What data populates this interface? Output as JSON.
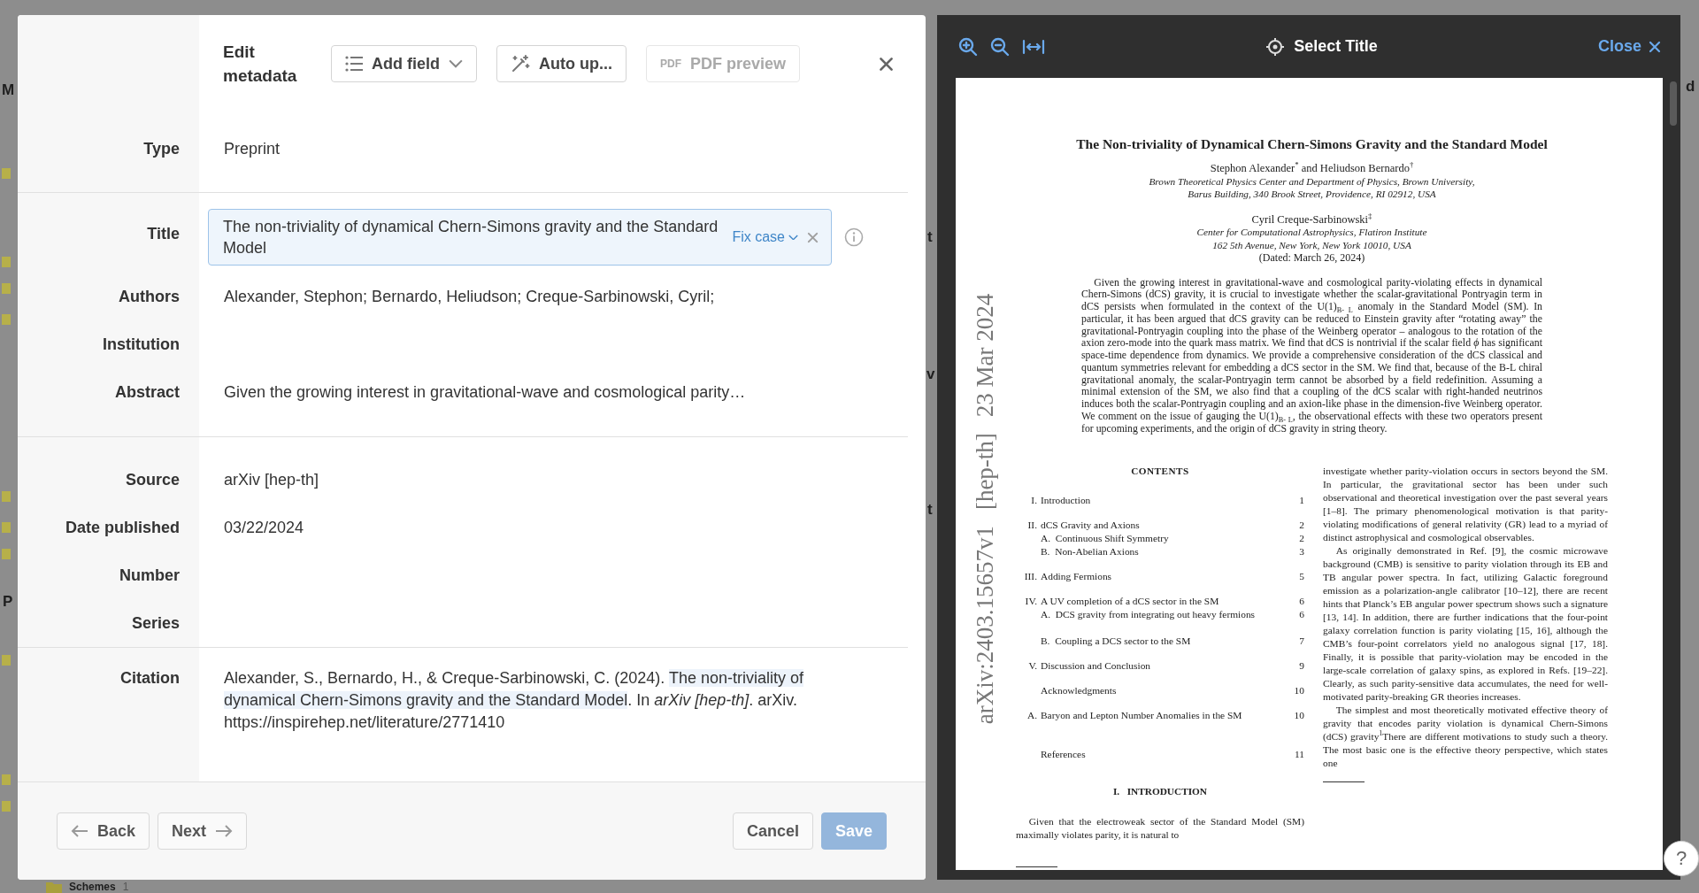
{
  "background": {
    "fragments": [
      {
        "text": "M"
      },
      {
        "text": "P"
      },
      {
        "text": "t"
      },
      {
        "text": "v"
      },
      {
        "text": "t"
      },
      {
        "text": "d"
      }
    ],
    "folder": {
      "name": "Schemes",
      "count": "1"
    }
  },
  "dialog": {
    "title": "Edit metadata",
    "toolbar": [
      {
        "kind": "list",
        "label": "Add field",
        "dropdown": true,
        "disabled": false
      },
      {
        "kind": "wand",
        "label": "Auto up...",
        "dropdown": false,
        "disabled": false
      },
      {
        "kind": "pdf",
        "badge": "PDF",
        "label": "PDF preview",
        "dropdown": false,
        "disabled": true
      }
    ],
    "groups": [
      [
        {
          "label": "Type",
          "value": "Preprint",
          "kind": "text"
        }
      ],
      [
        {
          "label": "Title",
          "value": "The non-triviality of dynamical Chern-Simons gravity and the Standard Model",
          "kind": "input",
          "action": "Fix case"
        },
        {
          "label": "Authors",
          "value": "Alexander, Stephon; Bernardo, Heliudson; Creque-Sarbinowski, Cyril;",
          "kind": "text"
        },
        {
          "label": "Institution",
          "kind": "text"
        },
        {
          "label": "Abstract",
          "value": "Given the growing interest in gravitational-wave and cosmological parity…",
          "kind": "text"
        }
      ],
      [
        {
          "label": "Source",
          "value": "arXiv [hep-th]",
          "kind": "text"
        },
        {
          "label": "Date published",
          "value": "03/22/2024",
          "kind": "text"
        },
        {
          "label": "Number",
          "kind": "text"
        },
        {
          "label": "Series",
          "kind": "text"
        }
      ]
    ],
    "citation": {
      "label": "Citation",
      "before": "Alexander, S., Bernardo, H., & Creque-Sarbinowski, C. (2024). ",
      "highlight": "The non-triviality of dynamical Chern-Simons gravity and the Standard Model",
      "after": ". In *arXiv [hep-th]*. arXiv. https://inspirehep.net/literature/2771410"
    },
    "footer": {
      "back": "Back",
      "next": "Next",
      "cancel": "Cancel",
      "save": "Save",
      "save_disabled": true
    }
  },
  "viewer": {
    "mode": "Select Title",
    "close": "Close",
    "stamp": [
      "arXiv:2403.15657v1",
      "[hep-th]",
      "23 Mar 2024"
    ],
    "page": {
      "title": "The Non-triviality of Dynamical Chern-Simons Gravity and the Standard Model",
      "front": [
        {
          "kind": "names",
          "text": "Stephon Alexander$^{*}$ and Heliudson Bernardo$^{†}$"
        },
        {
          "kind": "affiliation",
          "text": "Brown Theoretical Physics Center and Department of Physics, Brown University,"
        },
        {
          "kind": "affiliation",
          "text": "Barus Building, 340 Brook Street, Providence, RI 02912, USA"
        },
        {
          "kind": "names",
          "text": "Cyril Creque-Sarbinowski$^{‡}$"
        },
        {
          "kind": "affiliation",
          "text": "Center for Computational Astrophysics, Flatiron Institute"
        },
        {
          "kind": "affiliation",
          "text": "162 5th Avenue, New York, New York 10010, USA"
        },
        {
          "kind": "date",
          "text": "(Dated: March 26, 2024)"
        }
      ],
      "abstract": "Given the growing interest in gravitational-wave and cosmological parity-violating effects in dynamical Chern-Simons (dCS) gravity, it is crucial to investigate whether the scalar-gravitational Pontryagin term in dCS persists when formulated in the context of the U(1)$_{B- L}$ anomaly in the Standard Model (SM). In particular, it has been argued that dCS gravity can be reduced to Einstein gravity after “rotating away” the gravitational-Pontryagin coupling into the phase of the Weinberg operator – analogous to the rotation of the axion zero-mode into the quark mass matrix.  We find that dCS is nontrivial if the scalar field *ϕ* has significant space-time dependence from dynamics. We provide a comprehensive consideration of the dCS classical and quantum symmetries relevant for embedding a dCS sector in the SM. We find that, because of the B-L chiral gravitational anomaly, the scalar-Pontryagin term cannot be absorbed by a field redefinition. Assuming a minimal extension of the SM, we also find that a coupling of the dCS scalar with right-handed neutrinos induces both the scalar-Pontryagin coupling and an axion-like phase in the dimension-five Weinberg operator.  We comment on the issue of gauging the U(1)$_{B- L}$, the observational effects with these two operators present for upcoming experiments, and the origin of dCS gravity in string theory.",
      "contents_heading": "CONTENTS",
      "toc": [
        {
          "kind": "section",
          "number": "I.",
          "title": "Introduction",
          "page": "1"
        },
        {
          "kind": "section",
          "number": "II.",
          "title": "dCS Gravity and Axions",
          "page": "2"
        },
        {
          "kind": "subsection",
          "number": "A.",
          "title": "Continuous Shift Symmetry",
          "page": "2"
        },
        {
          "kind": "subsection",
          "number": "B.",
          "title": "Non-Abelian Axions",
          "page": "3"
        },
        {
          "kind": "section",
          "number": "III.",
          "title": "Adding Fermions",
          "page": "5"
        },
        {
          "kind": "section",
          "number": "IV.",
          "title": "A UV completion of a dCS sector in the SM",
          "page": "6"
        },
        {
          "kind": "subsection",
          "number": "A.",
          "title": "DCS gravity from integrating out heavy fermions",
          "page": "6"
        },
        {
          "kind": "subsection",
          "number": "B.",
          "title": "Coupling a DCS sector to the SM",
          "page": "7"
        },
        {
          "kind": "section",
          "number": "V.",
          "title": "Discussion and Conclusion",
          "page": "9"
        },
        {
          "kind": "section",
          "title": "Acknowledgments",
          "page": "10"
        },
        {
          "kind": "section",
          "number": "A.",
          "title": "Baryon and Lepton Number Anomalies in the SM",
          "page": "10"
        },
        {
          "kind": "section",
          "title": "References",
          "page": "11"
        }
      ],
      "section_heading": "I.   INTRODUCTION",
      "left_paragraph": "Given that the electroweak sector of the Standard Model (SM) maximally violates parity, it is natural to",
      "right_paragraphs": [
        "investigate whether parity-violation occurs in sectors beyond the SM. In particular, the gravitational sector has been under such observational and theoretical investigation over the past several years [1–8]. The primary phenomenological motivation is that parity-violating modifications of general relativity (GR) lead to a myriad of distinct astrophysical and cosmological observables.",
        "As originally demonstrated in Ref. [9], the cosmic microwave background (CMB) is sensitive to parity violation through its EB and TB angular power spectra.  In fact, utilizing Galactic foreground emission as a polarization-angle calibrator [10–12], there are recent hints that Planck’s EB angular power spectrum shows such a signature [13, 14].  In addition, there are further indications that the four-point galaxy correlation function is parity violating [15, 16], although the CMB’s four-point correlators yield no analogous signal [17, 18].  Finally, it is possible that parity-violation may be encoded in the large-scale correlation of galaxy spins, as explored in Refs. [19–22].  Clearly, as such parity-sensitive data accumulates, the need for well-motivated parity-breaking GR theories increases.",
        "The simplest and most theoretically motivated effective theory of gravity that encodes parity violation is dynamical Chern-Simons (dCS) gravity$^{1}$There are different motivations to study such a theory.  The most basic one is the effective theory perspective, which states one"
      ]
    },
    "help": "?"
  }
}
